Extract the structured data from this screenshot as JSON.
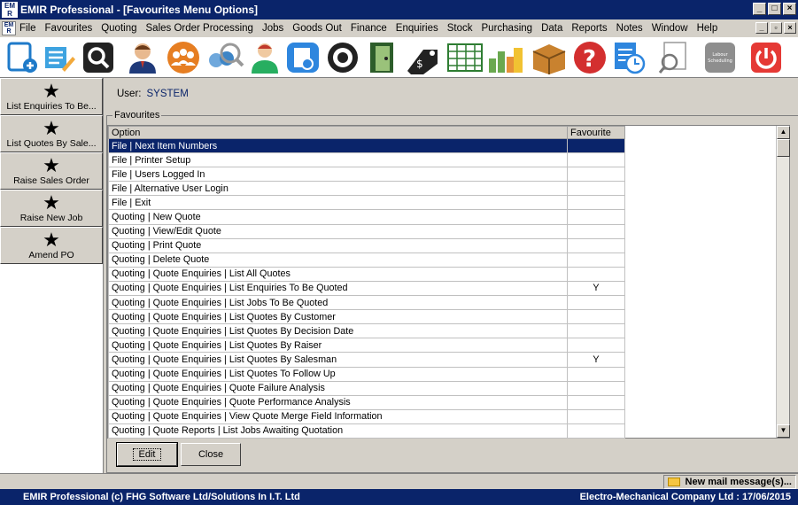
{
  "window": {
    "title": "EMIR Professional - [Favourites Menu Options]",
    "icon_text": "EM R"
  },
  "menu": [
    "File",
    "Favourites",
    "Quoting",
    "Sales Order Processing",
    "Jobs",
    "Goods Out",
    "Finance",
    "Enquiries",
    "Stock",
    "Purchasing",
    "Data",
    "Reports",
    "Notes",
    "Window",
    "Help"
  ],
  "toolbar": {
    "icons": [
      "new-document-icon",
      "notes-icon",
      "search-icon",
      "user-icon",
      "group-icon",
      "find-people-icon",
      "contact-icon",
      "document-icon",
      "settings-icon",
      "door-icon",
      "price-tag-icon",
      "spreadsheet-icon",
      "charts-icon",
      "box-icon",
      "help-icon",
      "schedule-icon",
      "magnifier-icon",
      "labour-scheduling-icon",
      "power-icon"
    ],
    "labour_label": "Labour Scheduling"
  },
  "sidebar": {
    "items": [
      {
        "label": "List Enquiries To Be...",
        "icon": "star-icon"
      },
      {
        "label": "List Quotes By Sale...",
        "icon": "star-icon"
      },
      {
        "label": "Raise Sales Order",
        "icon": "star-icon"
      },
      {
        "label": "Raise New Job",
        "icon": "star-icon"
      },
      {
        "label": "Amend PO",
        "icon": "star-icon"
      }
    ]
  },
  "user": {
    "label": "User:",
    "value": "SYSTEM"
  },
  "favourites": {
    "group_label": "Favourites",
    "columns": [
      "Option",
      "Favourite"
    ],
    "rows": [
      {
        "option": "File | Next Item Numbers",
        "favourite": ""
      },
      {
        "option": "File | Printer Setup",
        "favourite": ""
      },
      {
        "option": "File | Users Logged In",
        "favourite": ""
      },
      {
        "option": "File | Alternative User Login",
        "favourite": ""
      },
      {
        "option": "File | Exit",
        "favourite": ""
      },
      {
        "option": "Quoting | New Quote",
        "favourite": ""
      },
      {
        "option": "Quoting | View/Edit Quote",
        "favourite": ""
      },
      {
        "option": "Quoting | Print Quote",
        "favourite": ""
      },
      {
        "option": "Quoting | Delete Quote",
        "favourite": ""
      },
      {
        "option": "Quoting | Quote Enquiries | List All Quotes",
        "favourite": ""
      },
      {
        "option": "Quoting | Quote Enquiries | List Enquiries To Be Quoted",
        "favourite": "Y"
      },
      {
        "option": "Quoting | Quote Enquiries | List Jobs To Be Quoted",
        "favourite": ""
      },
      {
        "option": "Quoting | Quote Enquiries | List Quotes By Customer",
        "favourite": ""
      },
      {
        "option": "Quoting | Quote Enquiries | List Quotes By Decision Date",
        "favourite": ""
      },
      {
        "option": "Quoting | Quote Enquiries | List Quotes By Raiser",
        "favourite": ""
      },
      {
        "option": "Quoting | Quote Enquiries | List Quotes By Salesman",
        "favourite": "Y"
      },
      {
        "option": "Quoting | Quote Enquiries | List Quotes To Follow Up",
        "favourite": ""
      },
      {
        "option": "Quoting | Quote Enquiries | Quote Failure Analysis",
        "favourite": ""
      },
      {
        "option": "Quoting | Quote Enquiries | Quote Performance Analysis",
        "favourite": ""
      },
      {
        "option": "Quoting | Quote Enquiries | View Quote Merge Field Information",
        "favourite": ""
      },
      {
        "option": "Quoting | Quote Reports | List Jobs Awaiting Quotation",
        "favourite": ""
      }
    ]
  },
  "buttons": {
    "edit": "Edit",
    "close": "Close"
  },
  "status": {
    "mail": "New mail message(s)...",
    "left": "EMIR Professional (c) FHG Software Ltd/Solutions In I.T. Ltd",
    "right": "Electro-Mechanical Company Ltd : 17/06/2015"
  }
}
